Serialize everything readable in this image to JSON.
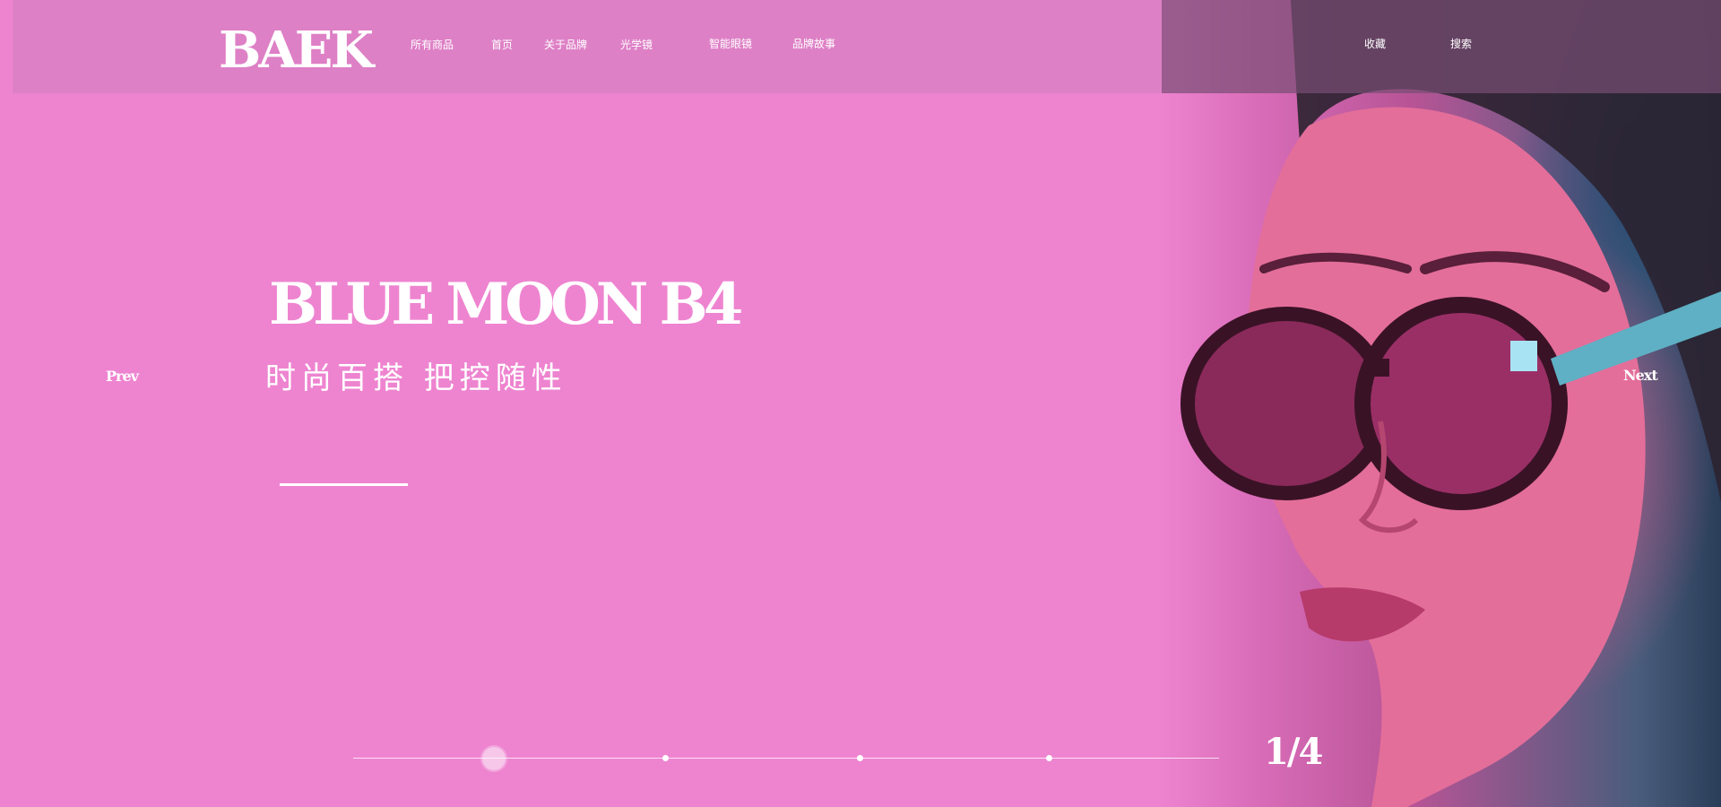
{
  "brand": {
    "logo": "BAEK"
  },
  "nav": {
    "items": [
      {
        "label": "所有商品"
      },
      {
        "label": "首页"
      },
      {
        "label": "关于品牌"
      },
      {
        "label": "光学镜"
      },
      {
        "label": "智能眼镜"
      },
      {
        "label": "品牌故事"
      }
    ],
    "right": [
      {
        "label": "收藏"
      },
      {
        "label": "搜索"
      }
    ]
  },
  "hero": {
    "title": "BLUE MOON B4",
    "subtitle": "时尚百搭  把控随性"
  },
  "slider": {
    "prev_label": "Prev",
    "next_label": "Next",
    "counter": "1/4",
    "current": 1,
    "total": 4
  },
  "colors": {
    "background": "#ee84d0",
    "text": "#ffffff"
  }
}
